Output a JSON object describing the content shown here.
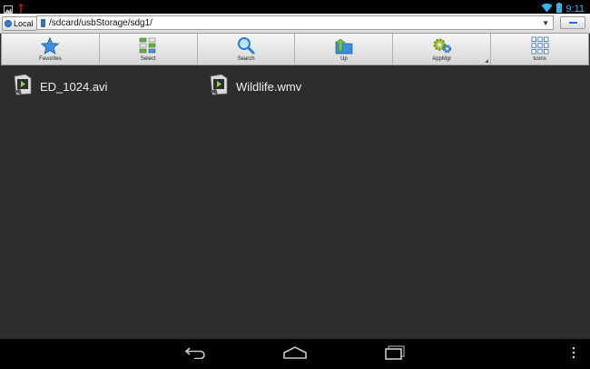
{
  "status": {
    "time": "9:11",
    "icons": [
      "picture-icon",
      "usb-icon",
      "wifi-icon",
      "battery-icon"
    ]
  },
  "pathbar": {
    "location_label": "Local",
    "path": "/sdcard/usbStorage/sdg1/"
  },
  "toolbar": {
    "items": [
      {
        "label": "Favorites",
        "icon": "star-icon"
      },
      {
        "label": "Select",
        "icon": "select-grid-icon"
      },
      {
        "label": "Search",
        "icon": "magnifier-icon"
      },
      {
        "label": "Up",
        "icon": "folder-up-icon"
      },
      {
        "label": "AppMgr",
        "icon": "gears-icon"
      },
      {
        "label": "Icons",
        "icon": "icon-grid-icon"
      }
    ]
  },
  "files": [
    {
      "name": "ED_1024.avi",
      "icon": "video-file-icon"
    },
    {
      "name": "Wildlife.wmv",
      "icon": "video-file-icon"
    }
  ],
  "navbar": {
    "buttons": [
      "back-icon",
      "home-icon",
      "recents-icon",
      "menu-icon"
    ]
  },
  "colors": {
    "background": "#2d2d2d",
    "accent": "#33b5e5",
    "toolbar": "#e6e6e6"
  }
}
